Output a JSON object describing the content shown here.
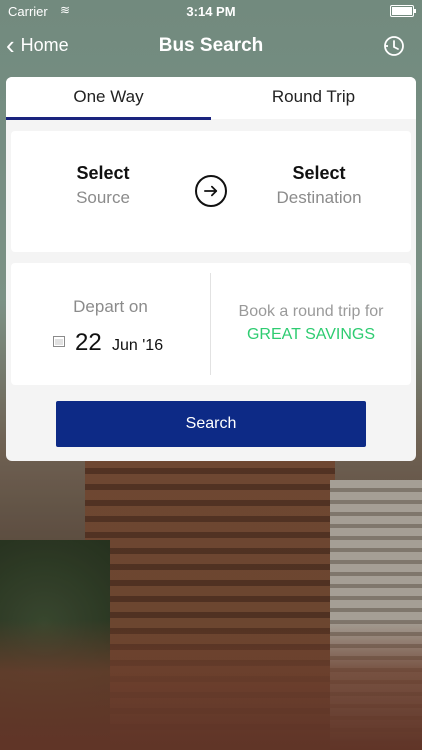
{
  "status": {
    "carrier": "Carrier",
    "time": "3:14 PM",
    "battery_level": 1.0
  },
  "nav": {
    "back_label": "Home",
    "title": "Bus Search"
  },
  "tabs": [
    {
      "label": "One Way",
      "selected": true
    },
    {
      "label": "Round Trip",
      "selected": false
    }
  ],
  "route": {
    "source_title": "Select",
    "source_sub": "Source",
    "dest_title": "Select",
    "dest_sub": "Destination"
  },
  "depart": {
    "label": "Depart on",
    "day": "22",
    "month_year": "Jun '16"
  },
  "promo": {
    "line1": "Book a round trip for",
    "line2": "GREAT SAVINGS"
  },
  "search": {
    "label": "Search"
  },
  "colors": {
    "primary": "#0d2a86",
    "tab_indicator": "#1a237e",
    "promo_green": "#2ecc71"
  },
  "icons": {
    "back": "chevron-left-icon",
    "history": "history-icon",
    "swap": "arrow-right-circle-icon",
    "calendar": "calendar-icon"
  }
}
